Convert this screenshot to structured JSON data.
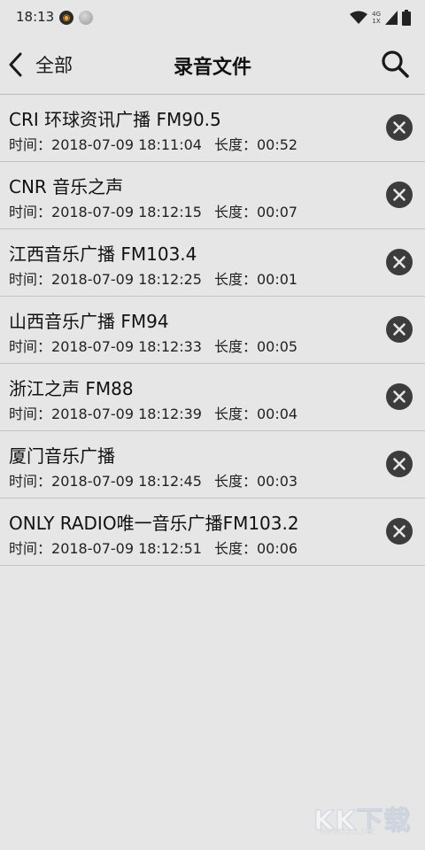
{
  "status_bar": {
    "time": "18:13",
    "network_label_top": "4G",
    "network_label_bottom": "1X",
    "icons": [
      "app-notification-icon",
      "dot-notification-icon",
      "wifi-icon",
      "signal-icon",
      "battery-icon"
    ]
  },
  "header": {
    "back_label": "全部",
    "title": "录音文件",
    "back_icon": "chevron-left-icon",
    "search_icon": "search-icon"
  },
  "recordings": [
    {
      "title": "CRI 环球资讯广播 FM90.5",
      "time_label": "时间：",
      "time": "2018-07-09 18:11:04",
      "duration_label": "长度：",
      "duration": "00:52"
    },
    {
      "title": "CNR 音乐之声",
      "time_label": "时间：",
      "time": "2018-07-09 18:12:15",
      "duration_label": "长度：",
      "duration": "00:07"
    },
    {
      "title": "江西音乐广播 FM103.4",
      "time_label": "时间：",
      "time": "2018-07-09 18:12:25",
      "duration_label": "长度：",
      "duration": "00:01"
    },
    {
      "title": "山西音乐广播 FM94",
      "time_label": "时间：",
      "time": "2018-07-09 18:12:33",
      "duration_label": "长度：",
      "duration": "00:05"
    },
    {
      "title": "浙江之声 FM88",
      "time_label": "时间：",
      "time": "2018-07-09 18:12:39",
      "duration_label": "长度：",
      "duration": "00:04"
    },
    {
      "title": "厦门音乐广播",
      "time_label": "时间：",
      "time": "2018-07-09 18:12:45",
      "duration_label": "长度：",
      "duration": "00:03"
    },
    {
      "title": "ONLY RADIO唯一音乐广播FM103.2",
      "time_label": "时间：",
      "time": "2018-07-09 18:12:51",
      "duration_label": "长度：",
      "duration": "00:06"
    }
  ],
  "watermark": {
    "text": "KK下载",
    "url": "www.kkx.net"
  },
  "colors": {
    "background": "#e6e6e6",
    "divider": "#c4c4c4",
    "delete_button": "#3c3c3c"
  }
}
